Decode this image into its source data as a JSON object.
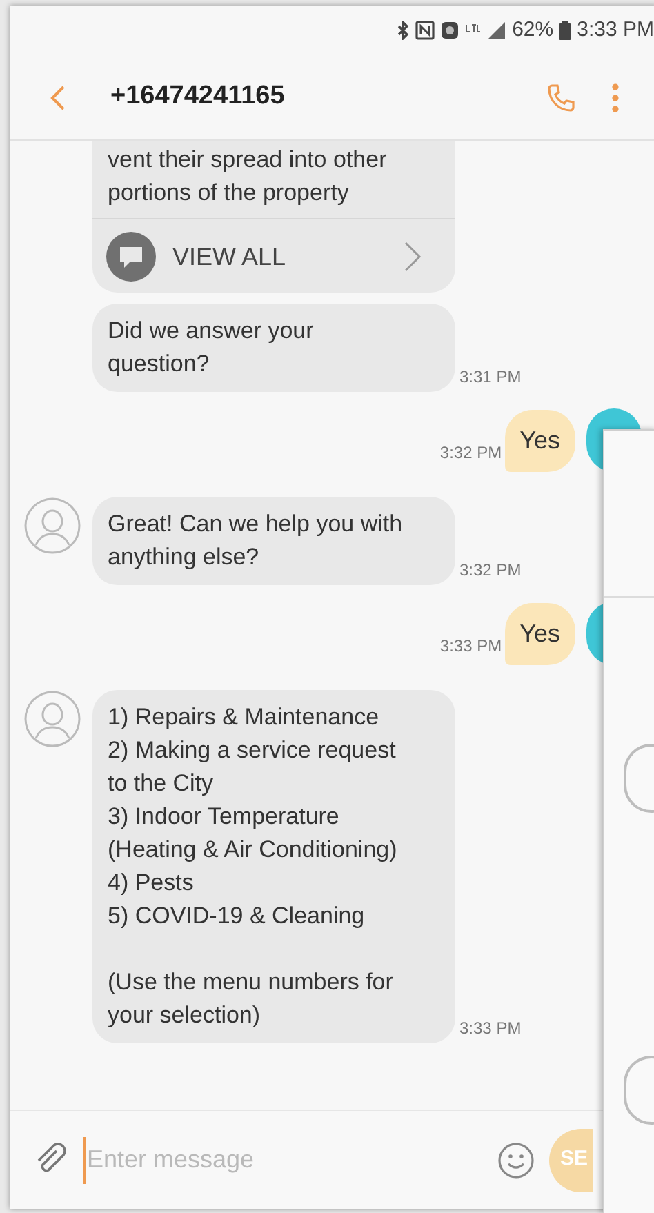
{
  "status_bar": {
    "battery": "62%",
    "time": "3:33 PM"
  },
  "header": {
    "title": "+16474241165"
  },
  "messages": [
    {
      "kind": "card",
      "text": "vent their spread into other\nportions of the property",
      "action": "VIEW ALL",
      "avatar": false
    },
    {
      "kind": "received",
      "text": "Did we answer your question?",
      "time": "3:31 PM",
      "avatar": false
    },
    {
      "kind": "sent",
      "text": "Yes",
      "time": "3:32 PM"
    },
    {
      "kind": "received",
      "text": "Great! Can we help you with anything else?",
      "time": "3:32 PM",
      "avatar": true
    },
    {
      "kind": "sent",
      "text": "Yes",
      "time": "3:33 PM"
    },
    {
      "kind": "received",
      "text": "1) Repairs & Maintenance\n2) Making a service request to the City\n3) Indoor Temperature (Heating & Air Conditioning)\n4) Pests\n5) COVID-19 & Cleaning\n\n(Use the menu numbers for your selection)",
      "time": "3:33 PM",
      "avatar": true
    }
  ],
  "composer": {
    "placeholder": "Enter message",
    "send": "SE"
  }
}
